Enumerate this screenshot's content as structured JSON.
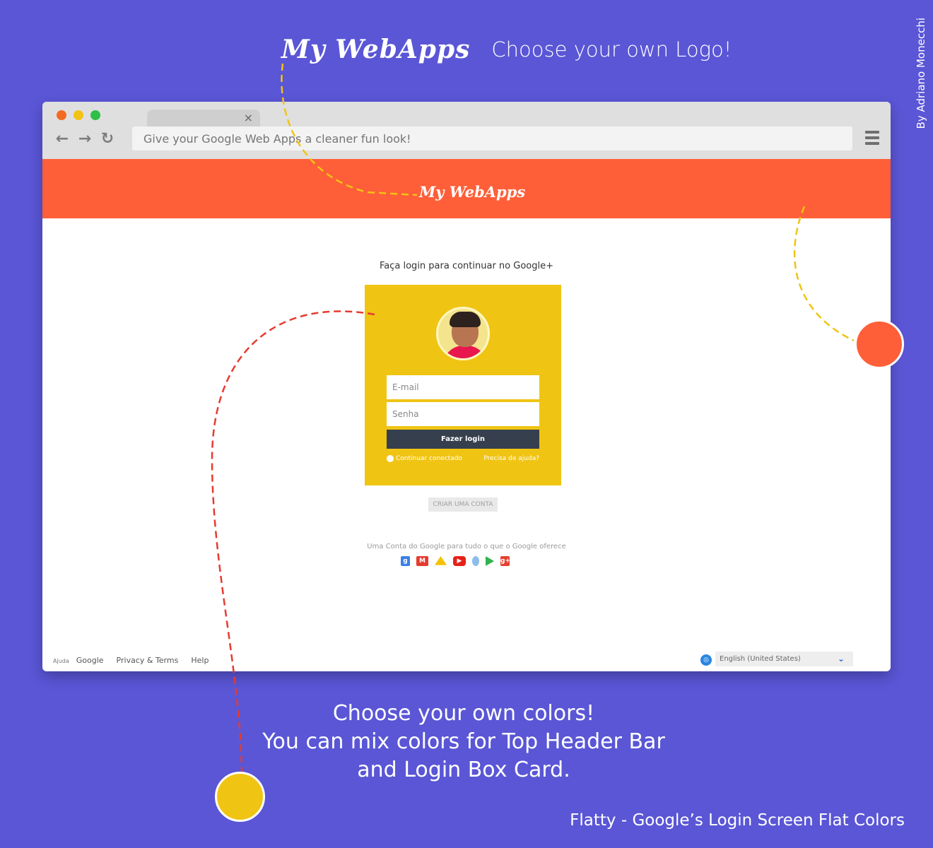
{
  "promo": {
    "logo_text": "My WebApps",
    "headline": "Choose your own Logo!",
    "byline": "By Adriano Monecchi",
    "bottom_lines": [
      "Choose your own colors!",
      "You can mix colors for Top Header Bar",
      "and Login Box Card."
    ],
    "credit": "Flatty - Google’s Login Screen Flat Colors"
  },
  "browser": {
    "tab_close": "×",
    "address_text": "Give your Google Web Apps a cleaner fun look!",
    "nav": {
      "back": "←",
      "forward": "→",
      "reload": "↻"
    }
  },
  "app": {
    "header_logo": "My WebApps",
    "prompt": "Faça login para continuar no Google+",
    "email_placeholder": "E-mail",
    "password_placeholder": "Senha",
    "login_button": "Fazer login",
    "remember_label": "Continuar conectado",
    "help_link": "Precisa de ajuda?",
    "create_account": "CRIAR UMA CONTA",
    "tagline": "Uma Conta do Google para tudo o que o Google oferece",
    "service_icons": {
      "google": "g",
      "gmail": "M",
      "drive": "",
      "youtube": "▶",
      "maps": "",
      "play": "",
      "gplus": "g+"
    },
    "footer": {
      "ajuda": "Ajuda",
      "google": "Google",
      "privacy": "Privacy & Terms",
      "help": "Help"
    },
    "language": "English (United States)",
    "language_chevron": "⌄",
    "globe": "◎"
  },
  "colors": {
    "background": "#5a56d6",
    "header": "#ff5f38",
    "card": "#f0c413",
    "button": "#353f4d"
  }
}
